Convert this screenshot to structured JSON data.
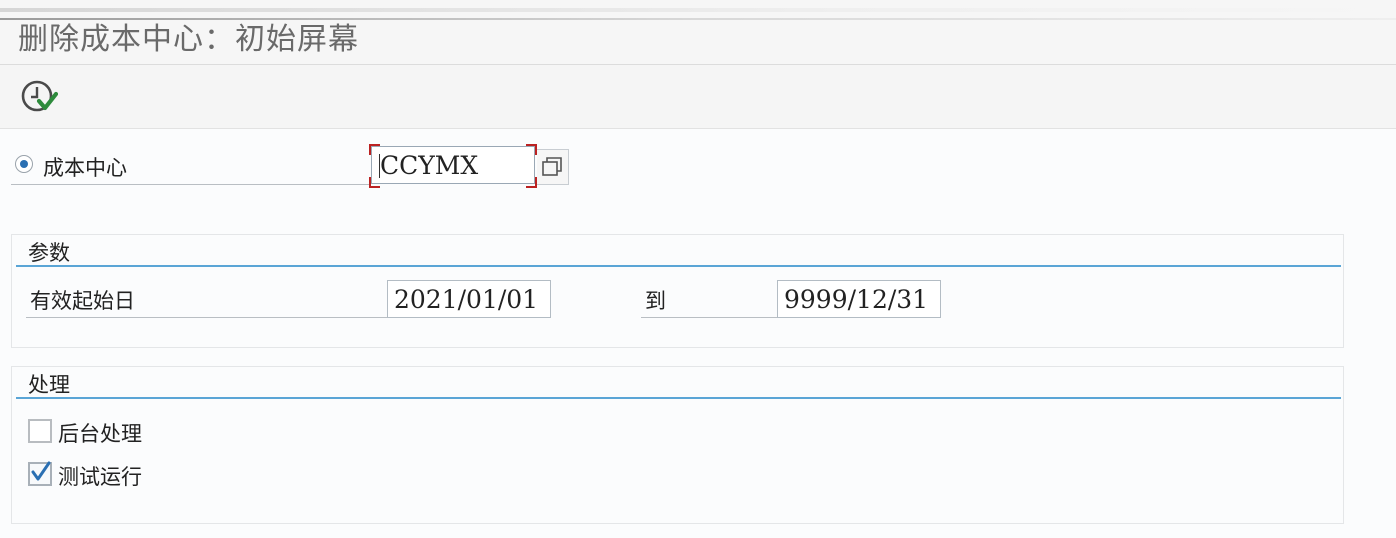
{
  "window": {
    "title": "删除成本中心：初始屏幕"
  },
  "toolbar": {
    "execute_icon": "execute-clock-check-icon",
    "icon_color": "#2e8b3c"
  },
  "selection": {
    "cost_center_label": "成本中心",
    "cost_center_value": "CCYMX",
    "cost_center_selected": true
  },
  "parameters": {
    "title": "参数",
    "valid_from_label": "有效起始日",
    "valid_from_value": "2021/01/01",
    "to_label": "到",
    "valid_to_value": "9999/12/31"
  },
  "processing": {
    "title": "处理",
    "background_label": "后台处理",
    "background_checked": false,
    "test_run_label": "测试运行",
    "test_run_checked": true
  },
  "colors": {
    "accent": "#5aa5d6",
    "focus": "#b22222",
    "radio": "#2a6fb2"
  }
}
